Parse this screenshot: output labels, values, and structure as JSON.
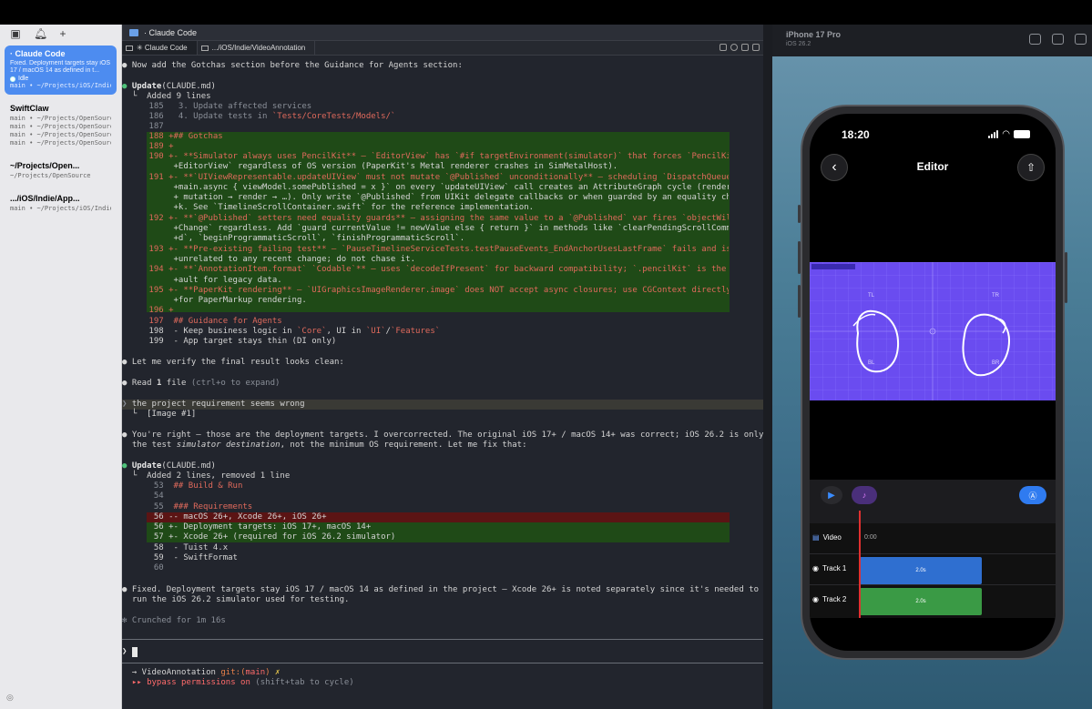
{
  "sidebar": {
    "sessions": [
      {
        "title": "· Claude Code",
        "message": "Fixed. Deployment targets stay iOS 17 / macOS 14 as defined in t...",
        "status": "Idle",
        "path": "main • ~/Projects/iOS/Indie..."
      },
      {
        "title": "SwiftClaw",
        "paths": [
          "main • ~/Projects/OpenSource...",
          "main • ~/Projects/OpenSource...",
          "main • ~/Projects/OpenSource...",
          "main • ~/Projects/OpenSource..."
        ]
      },
      {
        "title": "~/Projects/Open...",
        "path": "~/Projects/OpenSource"
      },
      {
        "title": ".../iOS/Indie/App...",
        "path": "main • ~/Projects/iOS/Indie..."
      }
    ]
  },
  "terminal": {
    "window_title": "· Claude Code",
    "tabs": [
      "✳ Claude Code",
      ".../iOS/Indie/VideoAnnotation"
    ],
    "lines": {
      "l1": "Now add the Gotchas section before the Guidance for Agents section:",
      "update1_a": "Update",
      "update1_b": "(CLAUDE.md)",
      "added9": "└  Added 9 lines",
      "c185": " 185   3. Update affected services",
      "c186": " 186   4. Update tests in ",
      "c186b": "`Tests/CoreTests/Models/`",
      "c187": " 187",
      "c188": " 188 +## Gotchas",
      "c189": " 189 +",
      "c190": " 190 +- **Simulator always uses PencilKit** — `EditorView` has `#if targetEnvironment(simulator)` that forces `PencilKit",
      "c190b": "      +EditorView` regardless of OS version (PaperKit's Metal renderer crashes in SimMetalHost).",
      "c191": " 191 +- **`UIViewRepresentable.updateUIView` must not mutate `@Published` unconditionally** — scheduling `DispatchQueue.",
      "c191b": "      +main.async { viewModel.somePublished = x }` on every `updateUIView` call creates an AttributeGraph cycle (render →",
      "c191c": "      + mutation → render → …). Only write `@Published` from UIKit delegate callbacks or when guarded by an equality chec",
      "c191d": "      +k. See `TimelineScrollContainer.swift` for the reference implementation.",
      "c192": " 192 +- **`@Published` setters need equality guards** — assigning the same value to a `@Published` var fires `objectWill",
      "c192b": "      +Change` regardless. Add `guard currentValue != newValue else { return }` in methods like `clearPendingScrollComman",
      "c192c": "      +d`, `beginProgrammaticScroll`, `finishProgrammaticScroll`.",
      "c193": " 193 +- **Pre-existing failing test** — `PauseTimelineServiceTests.testPauseEvents_EndAnchorUsesLastFrame` fails and is",
      "c193b": "      +unrelated to any recent change; do not chase it.",
      "c194": " 194 +- **`AnnotationItem.format` `Codable`** — uses `decodeIfPresent` for backward compatibility; `.pencilKit` is the def",
      "c194b": "      +ault for legacy data.",
      "c195": " 195 +- **PaperKit rendering** — `UIGraphicsImageRenderer.image` does NOT accept async closures; use CGContext directly",
      "c195b": "      +for PaperMarkup rendering.",
      "c196": " 196 +",
      "c197": " 197  ## Guidance for Agents",
      "c198a": " 198  - Keep business logic in ",
      "c198b": "`Core`",
      "c198c": ", UI in ",
      "c198d": "`UI`",
      "c198e": "/",
      "c198f": "`Features`",
      "c199": " 199  - App target stays thin (DI only)",
      "verify": "Let me verify the final result looks clean:",
      "read_a": "Read ",
      "read_b": "1",
      "read_c": " file ",
      "read_d": "(ctrl+o to expand)",
      "user_prompt": "the project requirement seems wrong",
      "image_ref": "  [Image #1]",
      "reply1": "You're right — those are the deployment targets. I overcorrected. The original iOS 17+ / macOS 14+ was correct; iOS 26.2 is only",
      "reply2a": "the test ",
      "reply2b": "simulator destination",
      "reply2c": ", not the minimum OS requirement. Let me fix that:",
      "update2_a": "Update",
      "update2_b": "(CLAUDE.md)",
      "added2": "└  Added 2 lines, removed 1 line",
      "d53": "  53  ## Build & Run",
      "d54": "  54",
      "d55": "  55  ### Requirements",
      "d56r": "  56 -- macOS 26+, Xcode 26+, iOS 26+",
      "d56a": "  56 +- Deployment targets: iOS 17+, macOS 14+",
      "d57": "  57 +- Xcode 26+ (required for iOS 26.2 simulator)",
      "d58": "  58  - Tuist 4.x",
      "d59": "  59  - SwiftFormat",
      "d60": "  60",
      "fixed1": "Fixed. Deployment targets stay iOS 17 / macOS 14 as defined in the project — Xcode 26+ is noted separately since it's needed to",
      "fixed2": "run the iOS 26.2 simulator used for testing.",
      "crunched": "Crunched for 1m 16s",
      "prompt_arrow": "❯",
      "git_a": "→ VideoAnnotation ",
      "git_b": "git:(",
      "git_c": "main",
      "git_d": ")",
      "git_e": " ✗",
      "perm_a": "▸▸ bypass permissions on",
      "perm_b": " (shift+tab to cycle)"
    }
  },
  "simulator": {
    "device": "iPhone 17 Pro",
    "os": "iOS 26.2",
    "status_time": "18:20",
    "nav_title": "Editor",
    "video_labels": {
      "tl": "TL",
      "tr": "TR",
      "bl": "BL",
      "br": "BR"
    },
    "timeline": {
      "video_label": "Video",
      "video_time": "0:00",
      "track1_label": "Track 1",
      "track1_clip": "2.0s",
      "track2_label": "Track 2",
      "track2_clip": "2.0s"
    },
    "colors": {
      "track1": "#2f6fd0",
      "track2": "#3a9a45",
      "video": "#6a4cf0",
      "accent": "#2f7bf0"
    }
  }
}
